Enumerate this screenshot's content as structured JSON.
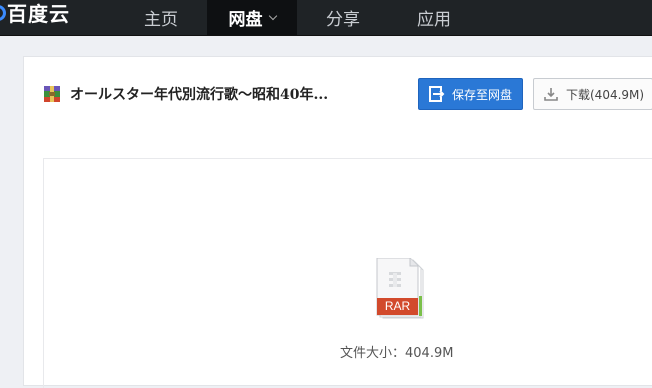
{
  "nav": {
    "logo_text": "百度云",
    "items": [
      {
        "label": "主页"
      },
      {
        "label": "网盘",
        "active": true
      },
      {
        "label": "分享"
      },
      {
        "label": "应用"
      }
    ]
  },
  "file": {
    "title": "オールスター年代別流行歌〜昭和40年...",
    "type_label": "RAR",
    "size_label": "文件大小：",
    "size_value": "404.9M"
  },
  "actions": {
    "save_label": "保存至网盘",
    "download_label": "下载(404.9M)"
  },
  "colors": {
    "topbar_bg": "#1f2326",
    "primary_button": "#2a78d6",
    "rar_red": "#d24a2c"
  }
}
